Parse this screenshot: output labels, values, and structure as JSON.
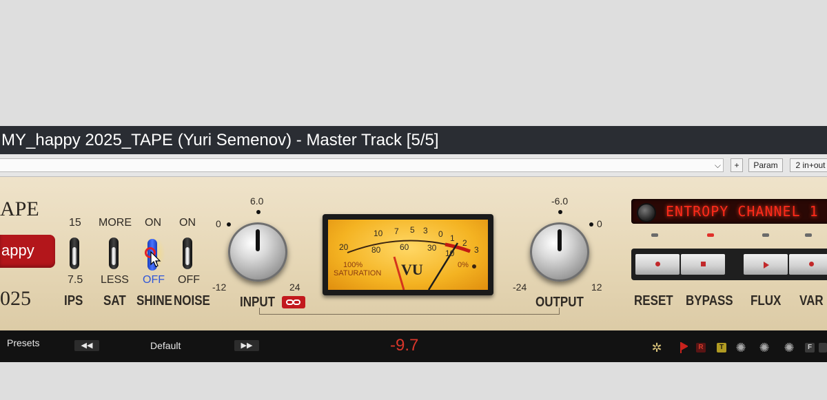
{
  "window": {
    "title": "MY_happy 2025_TAPE (Yuri Semenov) - Master Track [5/5]"
  },
  "toolbar": {
    "plus_label": "+",
    "param_label": "Param",
    "io_label": "2 in+out"
  },
  "plugin": {
    "brand_fragment": "APE",
    "name_badge": "appy",
    "year_fragment": "025",
    "switches": [
      {
        "name": "IPS",
        "top": "15",
        "bottom": "7.5"
      },
      {
        "name": "SAT",
        "top": "MORE",
        "bottom": "LESS"
      },
      {
        "name": "SHINE",
        "top": "ON",
        "bottom": "OFF"
      },
      {
        "name": "NOISE",
        "top": "ON",
        "bottom": "OFF"
      }
    ],
    "input": {
      "label": "INPUT",
      "scale_top": "6.0",
      "scale_left": "0",
      "scale_min": "-12",
      "scale_max": "24"
    },
    "vu": {
      "brand": "VU",
      "upper_scale": [
        "10",
        "7",
        "5",
        "3",
        "0",
        "1",
        "2",
        "3"
      ],
      "lower_scale": [
        "20",
        "80",
        "60",
        "30",
        "10"
      ],
      "percent_left": "100%",
      "saturation": "SATURATION",
      "percent_right": "0%"
    },
    "output": {
      "label": "OUTPUT",
      "scale_top": "-6.0",
      "scale_right": "0",
      "scale_min": "-24",
      "scale_max": "12"
    },
    "display_text": "ENTROPY CHANNEL 1",
    "buttons": [
      "RESET",
      "BYPASS",
      "FLUX",
      "VAR"
    ]
  },
  "bottom_bar": {
    "presets_label": "Presets",
    "prev_label": "◀◀",
    "preset_name": "Default",
    "next_label": "▶▶",
    "readout": "-9.7",
    "r_label": "R",
    "t_label": "T",
    "f_label": "F"
  }
}
